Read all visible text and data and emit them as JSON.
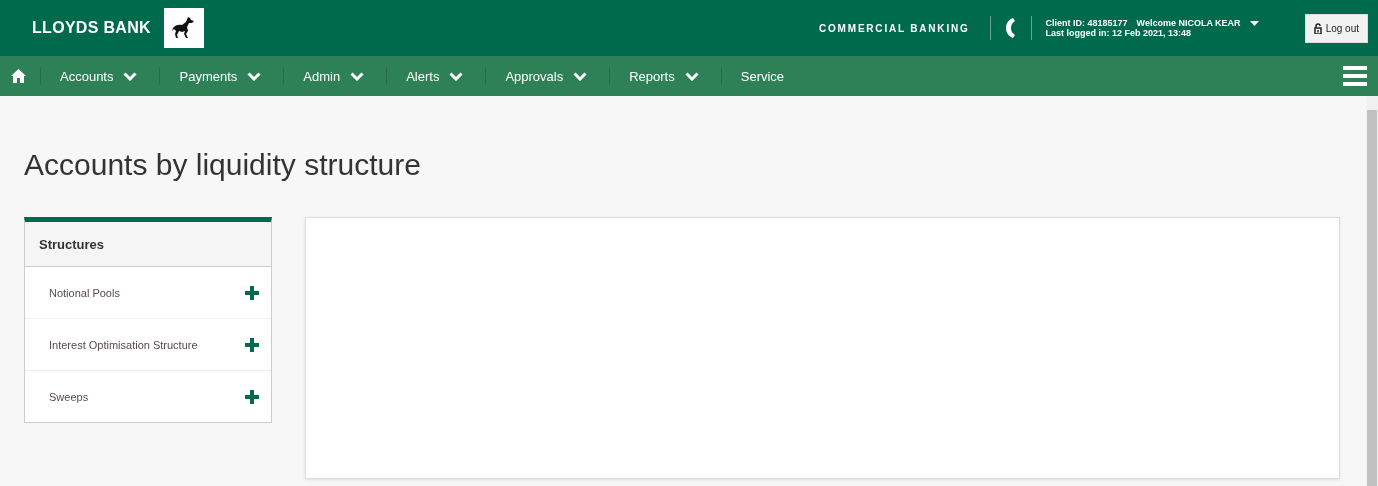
{
  "header": {
    "brand": "LLOYDS BANK",
    "division": "COMMERCIAL BANKING",
    "client_id": "Client ID: 48185177",
    "welcome": "Welcome NICOLA KEAR",
    "last_login": "Last logged in: 12 Feb 2021, 13:48",
    "logout": "Log out"
  },
  "nav": [
    {
      "label": "Accounts",
      "kind": "dropdown"
    },
    {
      "label": "Payments",
      "kind": "dropdown"
    },
    {
      "label": "Admin",
      "kind": "dropdown"
    },
    {
      "label": "Alerts",
      "kind": "dropdown"
    },
    {
      "label": "Approvals",
      "kind": "dropdown"
    },
    {
      "label": "Reports",
      "kind": "dropdown"
    },
    {
      "label": "Service",
      "kind": "link"
    }
  ],
  "page_title": "Accounts by liquidity structure",
  "structures": {
    "title": "Structures",
    "items": [
      {
        "label": "Notional Pools",
        "expanded": false
      },
      {
        "label": "Interest Optimisation Structure",
        "expanded": false
      },
      {
        "label": "Sweeps",
        "expanded": false
      }
    ]
  }
}
